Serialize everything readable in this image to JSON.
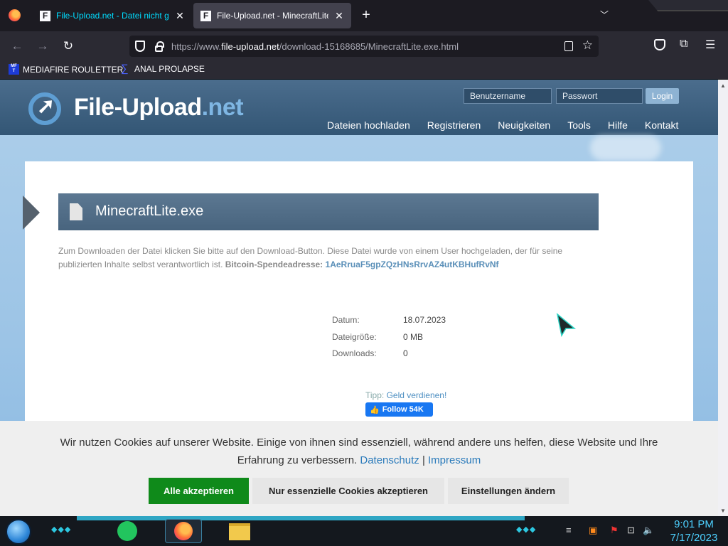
{
  "browser": {
    "tabs": [
      {
        "title": "File-Upload.net - Datei nicht gefunden",
        "favicon": "F"
      },
      {
        "title": "File-Upload.net - MinecraftLite.exe",
        "favicon": "F"
      }
    ],
    "url_prefix": "https://www.",
    "url_host": "file-upload.net",
    "url_path": "/download-15168685/MinecraftLite.exe.html",
    "bookmarks": [
      {
        "label": "MEDIAFIRE ROULETTER",
        "icon": "MF T"
      },
      {
        "label": "ANAL PROLAPSE",
        "icon": "sigma-icon"
      }
    ]
  },
  "site": {
    "logo_main": "File-Upload",
    "logo_tld": ".net",
    "login": {
      "username_placeholder": "Benutzername",
      "password_placeholder": "Passwort",
      "button": "Login"
    },
    "nav": [
      "Dateien hochladen",
      "Registrieren",
      "Neuigkeiten",
      "Tools",
      "Hilfe",
      "Kontakt"
    ]
  },
  "file": {
    "name": "MinecraftLite.exe",
    "description": "Zum Downloaden der Datei klicken Sie bitte auf den Download-Button. Diese Datei wurde von einem User hochgeladen, der für seine publizierten Inhalte selbst verantwortlich ist.",
    "donation_label": "Bitcoin-Spendeadresse:",
    "donation_address": "1AeRruaF5gpZQzHNsRrvAZ4utKBHufRvNf",
    "meta": [
      {
        "label": "Datum:",
        "value": "18.07.2023"
      },
      {
        "label": "Dateigröße:",
        "value": "0 MB"
      },
      {
        "label": "Downloads:",
        "value": "0"
      }
    ],
    "tip_label": "Tipp:",
    "tip_link": "Geld verdienen!",
    "fb_follow": "Follow 54K"
  },
  "cookie": {
    "text": "Wir nutzen Cookies auf unserer Website. Einige von ihnen sind essenziell, während andere uns helfen, diese Website und Ihre Erfahrung zu verbessern.",
    "privacy_link": "Datenschutz",
    "separator": "|",
    "imprint_link": "Impressum",
    "accept_all": "Alle akzeptieren",
    "accept_essential": "Nur essenzielle Cookies akzeptieren",
    "settings": "Einstellungen ändern"
  },
  "taskbar": {
    "time": "9:01 PM",
    "date": "7/17/2023"
  },
  "colors": {
    "browser_bg": "#1c1b22",
    "header_blue": "#335675",
    "accept_green": "#0f8a1a",
    "link_blue": "#2b7bbb",
    "clock_cyan": "#4dd0ff"
  }
}
